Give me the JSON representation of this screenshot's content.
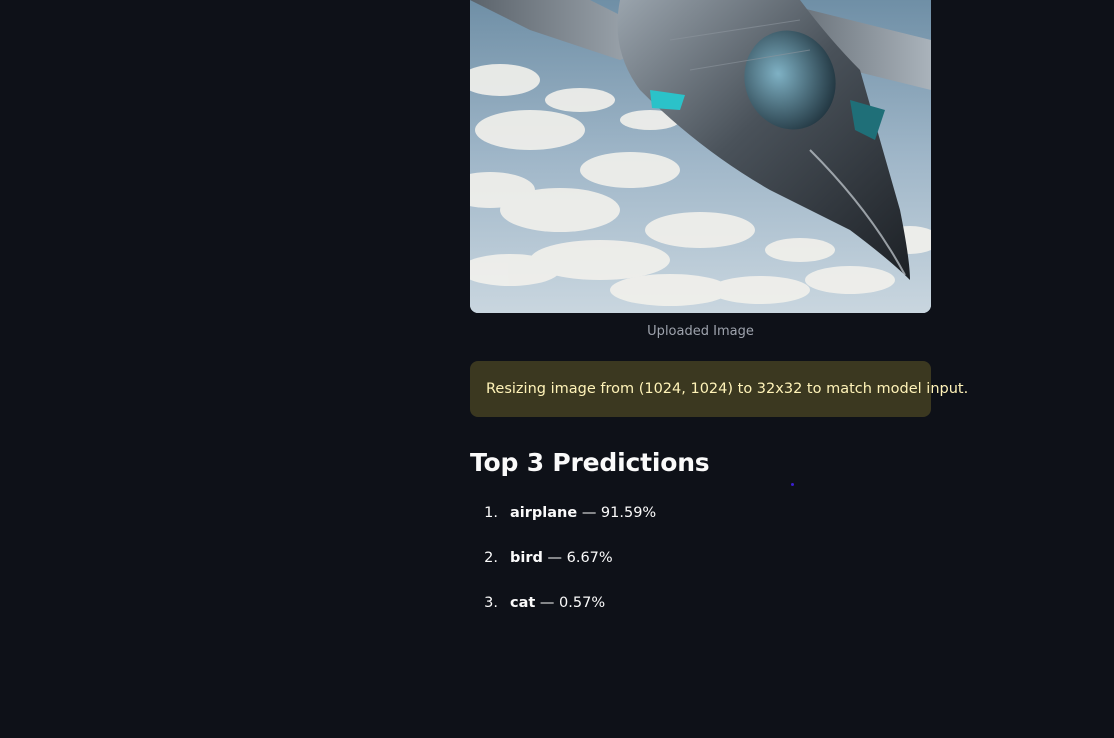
{
  "uploaded_image": {
    "caption": "Uploaded Image"
  },
  "alert": {
    "text": "Resizing image from (1024, 1024) to 32x32 to match model input."
  },
  "predictions": {
    "heading": "Top 3 Predictions",
    "separator": "—",
    "items": [
      {
        "rank": "1.",
        "label": "airplane",
        "value": "91.59%"
      },
      {
        "rank": "2.",
        "label": "bird",
        "value": "6.67%"
      },
      {
        "rank": "3.",
        "label": "cat",
        "value": "0.57%"
      }
    ]
  }
}
